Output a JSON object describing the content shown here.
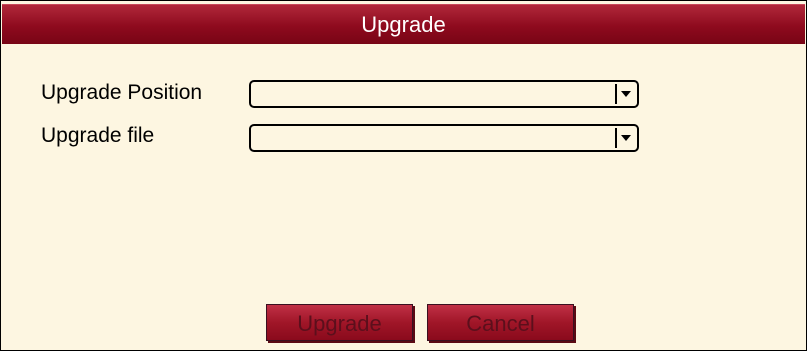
{
  "window": {
    "title": "Upgrade"
  },
  "form": {
    "position_label": "Upgrade Position",
    "position_value": "",
    "file_label": "Upgrade file",
    "file_value": ""
  },
  "buttons": {
    "upgrade_label": "Upgrade",
    "cancel_label": "Cancel"
  },
  "icons": {
    "dropdown": "chevron-down-icon"
  },
  "colors": {
    "titlebar": "#8e0a1e",
    "background": "#fdf6e1",
    "button": "#a01628"
  }
}
